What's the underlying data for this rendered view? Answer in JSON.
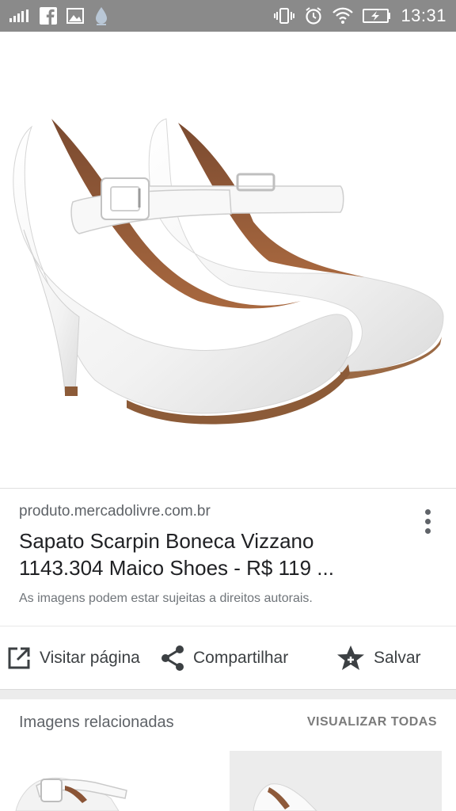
{
  "status_bar": {
    "time": "13:31",
    "left_icons": [
      "signal-icon",
      "facebook-icon",
      "image-icon",
      "drop-icon"
    ],
    "right_icons": [
      "vibrate-icon",
      "alarm-icon",
      "wifi-icon",
      "battery-icon"
    ]
  },
  "hero": {
    "icon": "white-platform-heels-image"
  },
  "result": {
    "source": "produto.mercadolivre.com.br",
    "title_line1": "Sapato Scarpin Boneca Vizzano",
    "title_line2": "1143.304 Maico Shoes - R$ 119 ...",
    "copyright": "As imagens podem estar sujeitas a direitos autorais."
  },
  "actions": {
    "visit": "Visitar página",
    "share": "Compartilhar",
    "save": "Salvar"
  },
  "related": {
    "title": "Imagens relacionadas",
    "view_all": "VISUALIZAR TODAS"
  },
  "colors": {
    "status_bar": "#8a8a8a",
    "text_primary": "#202124",
    "text_secondary": "#5f6368"
  }
}
